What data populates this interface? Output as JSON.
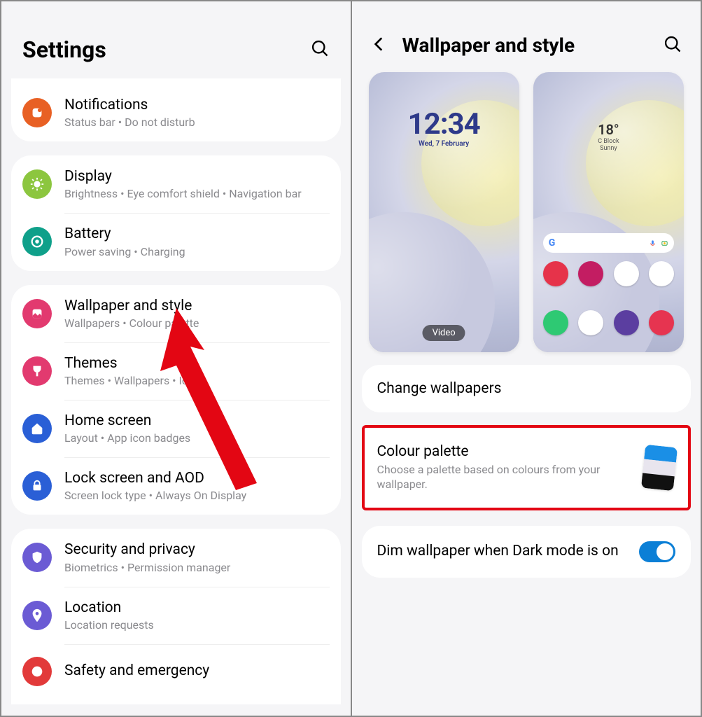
{
  "left": {
    "title": "Settings",
    "groups": [
      [
        {
          "icon": "notifications-icon",
          "color": "#e86024",
          "title": "Notifications",
          "sub": "Status bar  •  Do not disturb"
        }
      ],
      [
        {
          "icon": "display-icon",
          "color": "#8cc63f",
          "title": "Display",
          "sub": "Brightness  •  Eye comfort shield  •  Navigation bar"
        },
        {
          "icon": "battery-icon",
          "color": "#0fa08a",
          "title": "Battery",
          "sub": "Power saving  •  Charging"
        }
      ],
      [
        {
          "icon": "wallpaper-icon",
          "color": "#e23a6f",
          "title": "Wallpaper and style",
          "sub": "Wallpapers  •  Colour palette"
        },
        {
          "icon": "themes-icon",
          "color": "#e23a6f",
          "title": "Themes",
          "sub": "Themes  •  Wallpapers  •  Icons"
        },
        {
          "icon": "home-icon",
          "color": "#2a5fd6",
          "title": "Home screen",
          "sub": "Layout  •  App icon badges"
        },
        {
          "icon": "lock-icon",
          "color": "#2a5fd6",
          "title": "Lock screen and AOD",
          "sub": "Screen lock type  •  Always On Display"
        }
      ],
      [
        {
          "icon": "security-icon",
          "color": "#6b5bd4",
          "title": "Security and privacy",
          "sub": "Biometrics  •  Permission manager"
        },
        {
          "icon": "location-icon",
          "color": "#6b5bd4",
          "title": "Location",
          "sub": "Location requests"
        },
        {
          "icon": "sos-icon",
          "color": "#e23a3a",
          "title": "Safety and emergency",
          "sub": ""
        }
      ]
    ]
  },
  "right": {
    "title": "Wallpaper and style",
    "lock_time": "12:34",
    "lock_date": "Wed, 7 February",
    "video_badge": "Video",
    "home_temp": "18°",
    "home_loc": "C Block",
    "home_cond": "Sunny",
    "change_wallpapers": "Change wallpapers",
    "palette_title": "Colour palette",
    "palette_sub": "Choose a palette based on colours from your wallpaper.",
    "dim_label": "Dim wallpaper when Dark mode is on",
    "dim_on": true
  }
}
